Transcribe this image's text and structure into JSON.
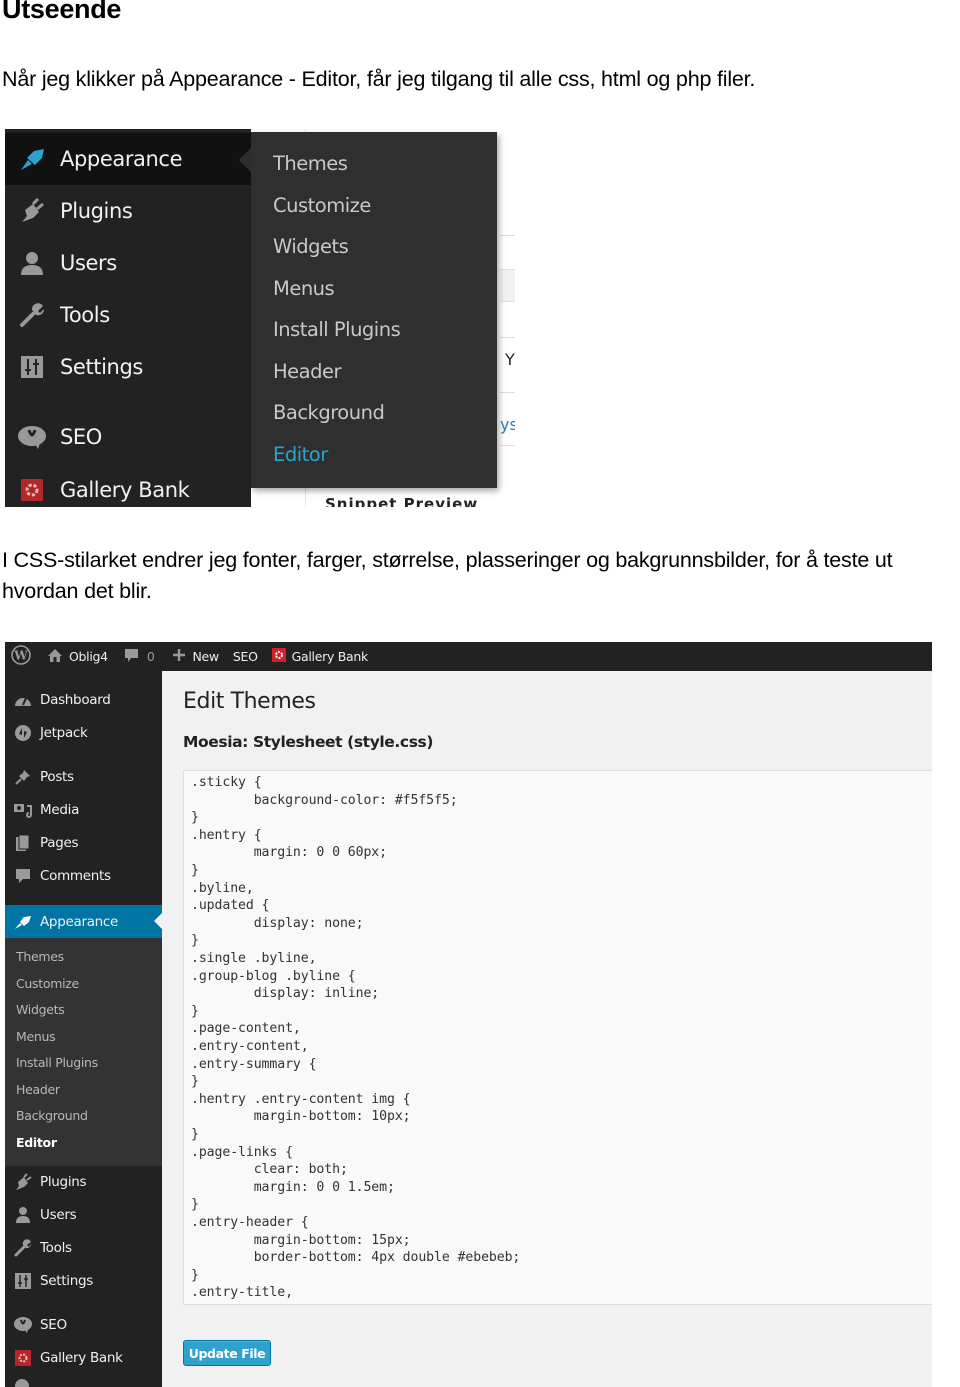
{
  "document": {
    "heading": "Utseende",
    "paragraph1": "Når jeg klikker på Appearance - Editor, får jeg tilgang til alle css, html og php filer.",
    "paragraph2": "I CSS-stilarket endrer jeg fonter, farger, størrelse, plasseringer og bakgrunnsbilder, for å teste ut hvordan det blir."
  },
  "screenshot1": {
    "menu": [
      {
        "label": "Appearance",
        "icon": "paintbrush-icon",
        "active": true
      },
      {
        "label": "Plugins",
        "icon": "plugin-icon"
      },
      {
        "label": "Users",
        "icon": "user-icon"
      },
      {
        "label": "Tools",
        "icon": "wrench-icon"
      },
      {
        "label": "Settings",
        "icon": "settings-icon"
      },
      {
        "label": "SEO",
        "icon": "seo-icon"
      },
      {
        "label": "Gallery Bank",
        "icon": "gallery-bank-icon"
      }
    ],
    "flyout": [
      {
        "label": "Themes"
      },
      {
        "label": "Customize"
      },
      {
        "label": "Widgets"
      },
      {
        "label": "Menus"
      },
      {
        "label": "Install Plugins"
      },
      {
        "label": "Header"
      },
      {
        "label": "Background"
      },
      {
        "label": "Editor",
        "current": true
      }
    ],
    "background_fragments": {
      "text_a": "Y",
      "text_b": "ys",
      "snippet": "Snippet Preview"
    }
  },
  "screenshot2": {
    "adminbar": {
      "site_name": "Oblig4",
      "comments_count": "0",
      "new_label": "New",
      "seo_label": "SEO",
      "gallery_label": "Gallery Bank"
    },
    "sidebar": {
      "top_items": [
        {
          "label": "Dashboard",
          "icon": "dashboard-icon"
        },
        {
          "label": "Jetpack",
          "icon": "jetpack-icon"
        }
      ],
      "content_items": [
        {
          "label": "Posts",
          "icon": "pin-icon"
        },
        {
          "label": "Media",
          "icon": "media-icon"
        },
        {
          "label": "Pages",
          "icon": "pages-icon"
        },
        {
          "label": "Comments",
          "icon": "comment-icon"
        }
      ],
      "active_item": {
        "label": "Appearance",
        "icon": "paintbrush-icon"
      },
      "submenu": [
        {
          "label": "Themes"
        },
        {
          "label": "Customize"
        },
        {
          "label": "Widgets"
        },
        {
          "label": "Menus"
        },
        {
          "label": "Install Plugins"
        },
        {
          "label": "Header"
        },
        {
          "label": "Background"
        },
        {
          "label": "Editor",
          "current": true
        }
      ],
      "bottom_items": [
        {
          "label": "Plugins",
          "icon": "plugin-icon"
        },
        {
          "label": "Users",
          "icon": "user-icon"
        },
        {
          "label": "Tools",
          "icon": "wrench-icon"
        },
        {
          "label": "Settings",
          "icon": "settings-icon"
        }
      ],
      "extra_items": [
        {
          "label": "SEO",
          "icon": "seo-icon"
        },
        {
          "label": "Gallery Bank",
          "icon": "gallery-bank-icon"
        }
      ]
    },
    "content": {
      "page_title": "Edit Themes",
      "file_title": "Moesia: Stylesheet (style.css)",
      "code_lines": [
        ".sticky {",
        "        background-color: #f5f5f5;",
        "}",
        ".hentry {",
        "        margin: 0 0 60px;",
        "}",
        ".byline,",
        ".updated {",
        "        display: none;",
        "}",
        ".single .byline,",
        ".group-blog .byline {",
        "        display: inline;",
        "}",
        ".page-content,",
        ".entry-content,",
        ".entry-summary {",
        "}",
        ".hentry .entry-content img {",
        "        margin-bottom: 10px;",
        "}",
        ".page-links {",
        "        clear: both;",
        "        margin: 0 0 1.5em;",
        "}",
        ".entry-header {",
        "        margin-bottom: 15px;",
        "        border-bottom: 4px double #ebebeb;",
        "}",
        ".entry-title,"
      ],
      "update_button": "Update File"
    }
  },
  "colors": {
    "wp_accent_blue": "#2ea2cc",
    "wp_active_blue": "#0074a2",
    "wp_menu_dark": "#222222",
    "wp_submenu": "#333333",
    "gallery_red": "#d54e21"
  }
}
